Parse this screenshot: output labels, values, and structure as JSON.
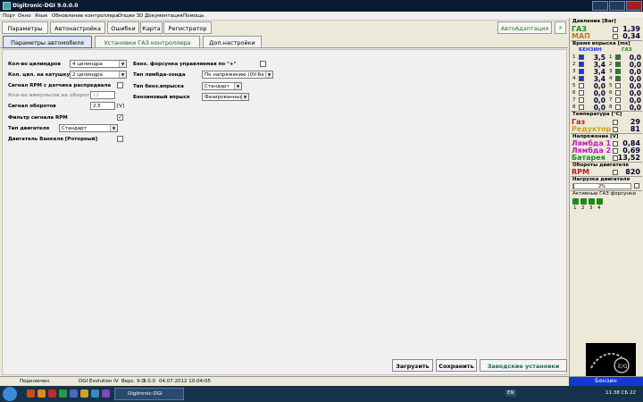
{
  "window": {
    "title": "Digitronic-DGI 9.0.0.0"
  },
  "menu": [
    "Порт",
    "Окно",
    "Язык",
    "Обновление контроллера",
    "Опции 3D",
    "Документация",
    "Помощь"
  ],
  "tabs": [
    "Параметры",
    "Автонастройка",
    "Ошибки",
    "Карта",
    "Регистратор"
  ],
  "auto_adapt": "АвтоАдаптация",
  "flash_icon": "lightning-icon",
  "subtabs": [
    "Параметры автомобиля",
    "Установки ГАЗ контроллера",
    "Доп.настройки"
  ],
  "form_left": {
    "cylinders_label": "Кол-во цилиндров",
    "cylinders_value": "4 цилиндра",
    "coil_label": "Кол. цил. на катушку",
    "coil_value": "2 цилиндра",
    "rpm_signal_label": "Сигнал RPM с датчика распредвала",
    "pulses_label": "Кол-во импульсов на оборот",
    "pulses_value": "12",
    "rpm_voltage_label": "Сигнал оборотов",
    "rpm_voltage_value": "2,5",
    "rpm_voltage_unit": "[V]",
    "rpm_filter_label": "Фильтр сигнала RPM",
    "engine_type_label": "Тип двигателя",
    "engine_type_value": "Стандарт",
    "wankel_label": "Двигатель Ванкеля [Роторный]"
  },
  "form_right": {
    "injector_label": "Бенз. форсунка управляемая по \"+\"",
    "lambda_type_label": "Тип лямбда-зонда",
    "lambda_type_value": "По напряжению (0V-Бе",
    "fuel_type_label": "Тип бенз.впрыска",
    "fuel_type_value": "Стандарт",
    "injection_label": "Бензиновый впрыск",
    "injection_value": "Фазированный"
  },
  "buttons": {
    "load": "Загрузить",
    "save": "Сохранить",
    "factory": "Заводские установки"
  },
  "side": {
    "pressure_header": "Давление [Bar]",
    "gas_label": "ГАЗ",
    "gas_value": "1,39",
    "map_label": "МАП",
    "map_value": "0,34",
    "inj_header": "Время впрыска [ms]",
    "benzin_col": "БЕНЗИН",
    "gaz_col": "ГАЗ",
    "injectors": [
      {
        "n": "1",
        "b": "3,5",
        "g": "0,0"
      },
      {
        "n": "2",
        "b": "3,4",
        "g": "0,0"
      },
      {
        "n": "3",
        "b": "3,4",
        "g": "0,0"
      },
      {
        "n": "4",
        "b": "3,4",
        "g": "0,0"
      },
      {
        "n": "5",
        "b": "0,0",
        "g": "0,0"
      },
      {
        "n": "6",
        "b": "0,0",
        "g": "0,0"
      },
      {
        "n": "7",
        "b": "0,0",
        "g": "0,0"
      },
      {
        "n": "8",
        "b": "0,0",
        "g": "0,0"
      }
    ],
    "temp_header": "Температура [°C]",
    "temp_gas_label": "Газ",
    "temp_gas_value": "29",
    "temp_red_label": "Редуктор",
    "temp_red_value": "81",
    "volt_header": "Напряжение [V]",
    "lambda1_label": "Лямбда 1",
    "lambda1_value": "0,84",
    "lambda2_label": "Лямбда 2",
    "lambda2_value": "0,69",
    "battery_label": "Батарея",
    "battery_value": "13,52",
    "rpm_header": "Обороты двигателя",
    "rpm_label": "RPM",
    "rpm_value": "820",
    "load_header": "Нагрузка двигателя",
    "load_value": "2%",
    "active_header": "Активные ГАЗ форсунки",
    "active": [
      "1",
      "2",
      "3",
      "4"
    ]
  },
  "status": {
    "connected": "Подключен",
    "device": "DGI Evolution IV",
    "version": "Верс. 9.0",
    "fw": "3.0.0",
    "date": "04.07.2012 10:04:05"
  },
  "fuel_mode": "Бензин",
  "taskbar": {
    "task": "Digitronic-DGI",
    "lang": "EN",
    "clock": "11:38 СБ 22"
  }
}
